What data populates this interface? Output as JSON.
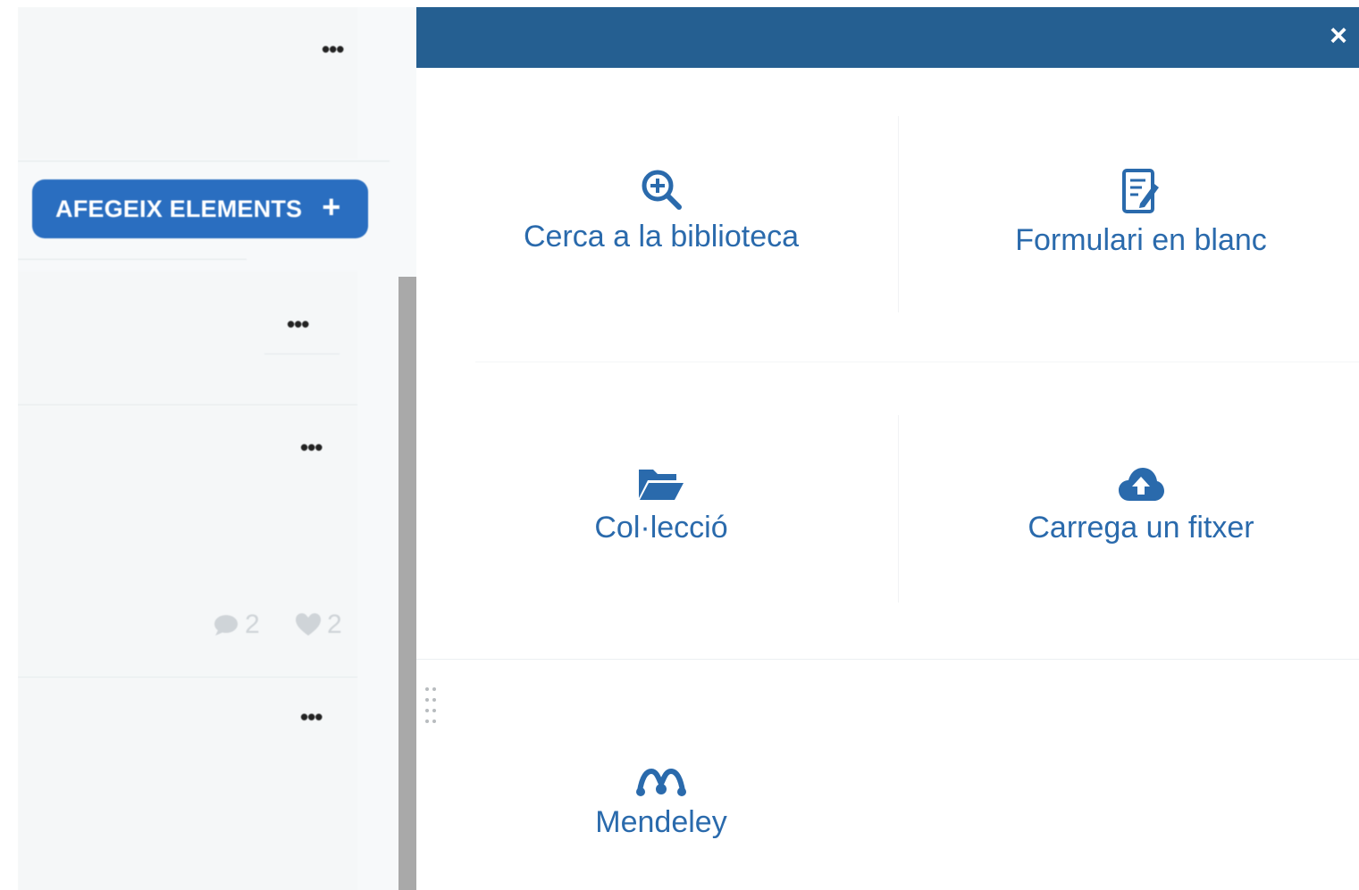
{
  "sidebar": {
    "more_label": "•••",
    "add_button": {
      "label": "AFEGEIX ELEMENTS",
      "plus": "+"
    },
    "cards": [
      {
        "comments": "",
        "likes": ""
      },
      {
        "comments": "2",
        "likes": "2"
      },
      {
        "comments": "",
        "likes": ""
      }
    ]
  },
  "modal": {
    "close_label": "×",
    "options": [
      {
        "label": "Cerca a la biblioteca",
        "icon": "search-plus-icon"
      },
      {
        "label": "Formulari en blanc",
        "icon": "form-edit-icon"
      },
      {
        "label": "Col·lecció",
        "icon": "folder-open-icon"
      },
      {
        "label": "Carrega un fitxer",
        "icon": "cloud-upload-icon"
      },
      {
        "label": "Mendeley",
        "icon": "mendeley-icon"
      }
    ]
  },
  "colors": {
    "header": "#255f91",
    "accent": "#2a6ec0",
    "option_text": "#2a6aac"
  }
}
